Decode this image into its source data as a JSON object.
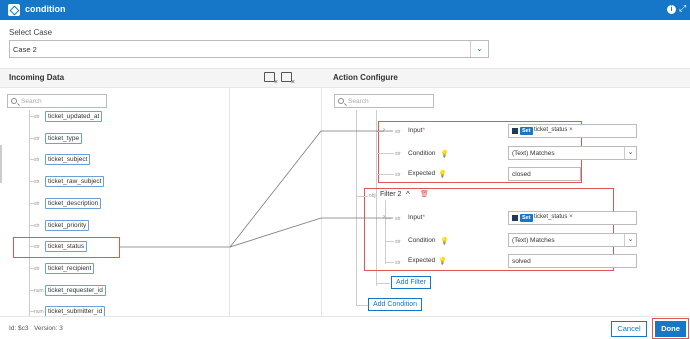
{
  "window": {
    "title": "condition",
    "accent": "#1677c9",
    "highlight": "#e05555"
  },
  "select_case": {
    "label": "Select Case",
    "value": "Case 2"
  },
  "incoming": {
    "title": "Incoming Data",
    "search_placeholder": "Search",
    "fields": [
      {
        "type": "str",
        "name": "ticket_updated_at"
      },
      {
        "type": "str",
        "name": "ticket_type"
      },
      {
        "type": "str",
        "name": "ticket_subject"
      },
      {
        "type": "str",
        "name": "ticket_raw_subject"
      },
      {
        "type": "str",
        "name": "ticket_description"
      },
      {
        "type": "str",
        "name": "ticket_priority"
      },
      {
        "type": "str",
        "name": "ticket_status"
      },
      {
        "type": "str",
        "name": "ticket_recipient"
      },
      {
        "type": "num",
        "name": "ticket_requester_id"
      },
      {
        "type": "num",
        "name": "ticket_submitter_id"
      }
    ]
  },
  "action": {
    "title": "Action Configure",
    "search_placeholder": "Search",
    "filter1": {
      "input_label": "Input",
      "input_tag": {
        "badge": "Set",
        "name": "ticket_status"
      },
      "condition_label": "Condition",
      "condition_value": "(Text) Matches",
      "expected_label": "Expected",
      "expected_value": "closed",
      "type_input": "str",
      "type_condition": "str",
      "type_expected": "str"
    },
    "filter2": {
      "type": "obj",
      "title": "Filter 2",
      "input_label": "Input",
      "input_tag": {
        "badge": "Set",
        "name": "ticket_status"
      },
      "condition_label": "Condition",
      "condition_value": "(Text) Matches",
      "expected_label": "Expected",
      "expected_value": "solved",
      "type_input": "str",
      "type_condition": "str",
      "type_expected": "str"
    },
    "add_filter_label": "Add Filter",
    "add_condition_label": "Add Condition"
  },
  "footer": {
    "id_text": "Id: $c3",
    "version_text": "Version: 3"
  },
  "buttons": {
    "cancel": "Cancel",
    "done": "Done"
  }
}
